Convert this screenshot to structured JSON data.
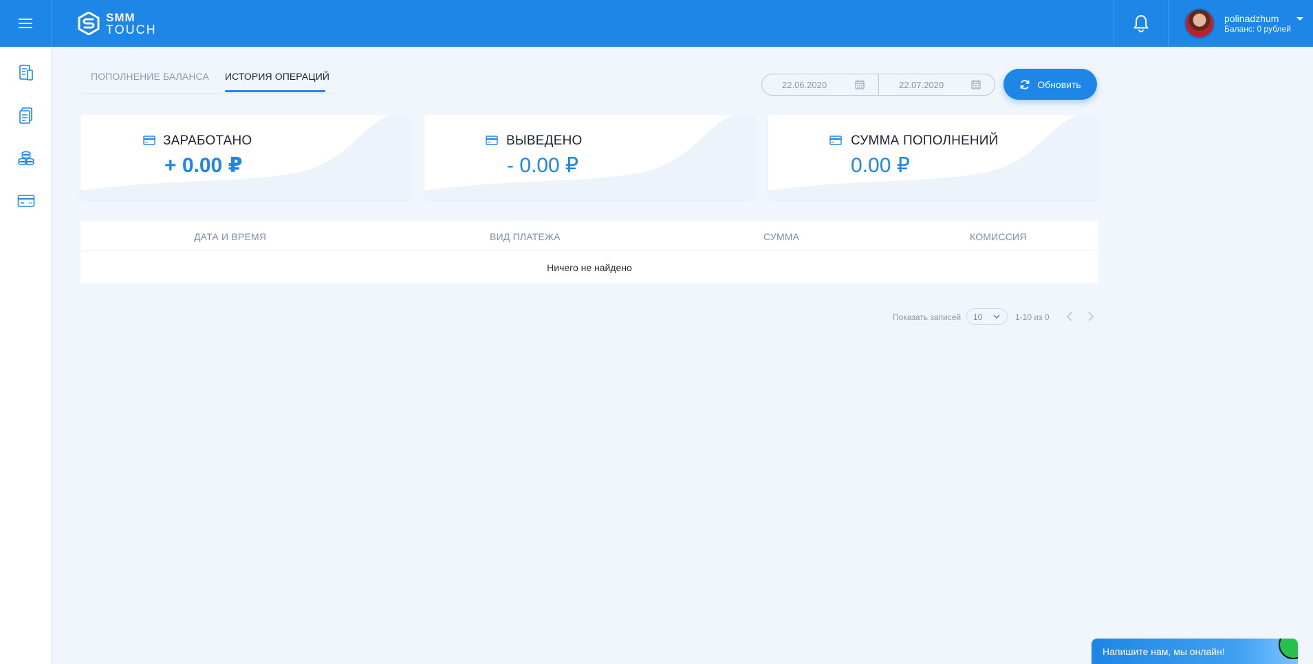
{
  "header": {
    "logo": {
      "line1": "SMM",
      "line2": "TOUCH"
    },
    "user": {
      "name": "polinadzhum",
      "balance": "Баланс: 0 рублей"
    },
    "colors": {
      "primary": "#1d86e6"
    }
  },
  "sidebar": {
    "items": [
      {
        "icon": "document-icon"
      },
      {
        "icon": "invoice-icon"
      },
      {
        "icon": "coins-icon"
      },
      {
        "icon": "card-icon"
      }
    ]
  },
  "tabs": [
    {
      "label": "ПОПОЛНЕНИЕ БАЛАНСА",
      "active": false
    },
    {
      "label": "ИСТОРИЯ ОПЕРАЦИЙ",
      "active": true
    }
  ],
  "filters": {
    "date_from": "22.06.2020",
    "date_to": "22.07.2020",
    "refresh_label": "Обновить"
  },
  "cards": [
    {
      "title": "ЗАРАБОТАНО",
      "value": "+ 0.00 ₽"
    },
    {
      "title": "ВЫВЕДЕНО",
      "value": "- 0.00 ₽"
    },
    {
      "title": "СУММА ПОПОЛНЕНИЙ",
      "value": "0.00 ₽"
    }
  ],
  "table": {
    "columns": [
      "ДАТА И ВРЕМЯ",
      "ВИД ПЛАТЕЖА",
      "СУММА",
      "КОМИССИЯ"
    ],
    "rows": [],
    "empty_text": "Ничего не найдено"
  },
  "pagination": {
    "label": "Показать записей",
    "page_size": "10",
    "range": "1-10 из 0"
  },
  "chat": {
    "label": "Напишите нам, мы онлайн!"
  }
}
